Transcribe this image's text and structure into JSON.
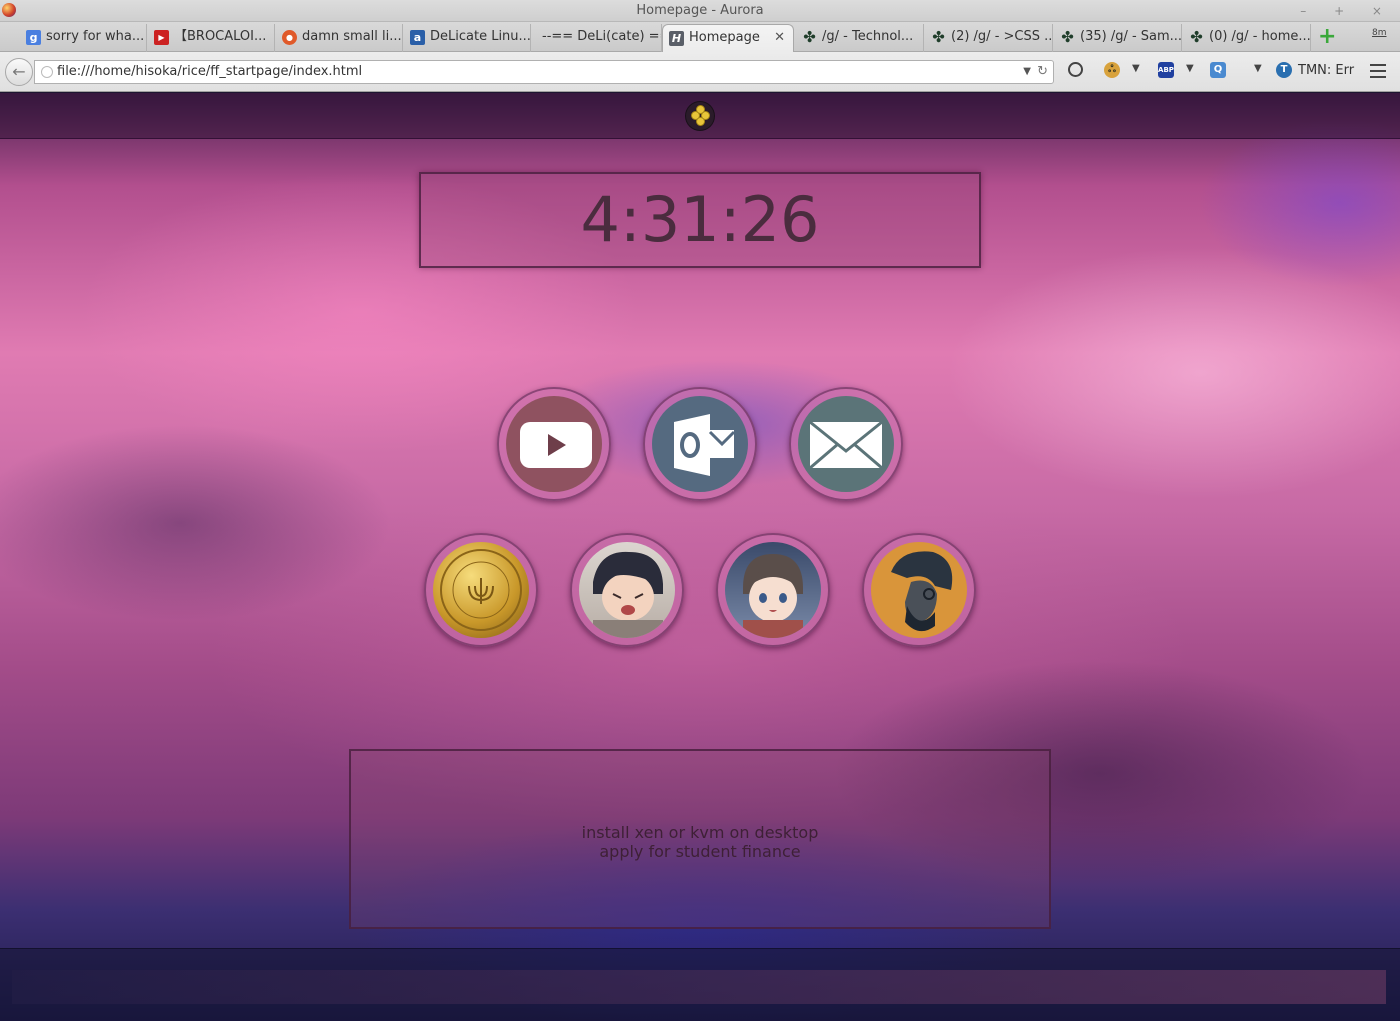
{
  "window": {
    "title": "Homepage - Aurora",
    "controls": "– + ×"
  },
  "tabs": [
    {
      "label": "sorry for wha...",
      "icon": "google-icon",
      "fav": "g",
      "color": "#4a7fe0"
    },
    {
      "label": "【BROCALOI...",
      "icon": "youtube-icon",
      "fav": "▶",
      "color": "#cc2222"
    },
    {
      "label": "damn small li...",
      "icon": "duckduckgo-icon",
      "fav": "●",
      "color": "#e05a2a"
    },
    {
      "label": "DeLicate Linu...",
      "icon": "site-a-icon",
      "fav": "a",
      "color": "#2a5fa8"
    },
    {
      "label": "--== DeLi(cate) ==--",
      "icon": "blank-page-icon",
      "fav": "",
      "color": "transparent"
    },
    {
      "label": "Homepage",
      "icon": "h-page-icon",
      "fav": "H",
      "color": "#5a5f68",
      "close": "✕"
    },
    {
      "label": "/g/ - Technol...",
      "icon": "4chan-clover-icon",
      "fav": "✤",
      "color": "transparent"
    },
    {
      "label": "(2) /g/ - >CSS ...",
      "icon": "4chan-clover-icon",
      "fav": "✤",
      "color": "transparent"
    },
    {
      "label": "(35) /g/ - Sam...",
      "icon": "4chan-clover-icon",
      "fav": "✤",
      "color": "transparent"
    },
    {
      "label": "(0) /g/ - home...",
      "icon": "4chan-clover-icon",
      "fav": "✤",
      "color": "transparent"
    }
  ],
  "new_tab": "+",
  "tab_count": "8m",
  "nav": {
    "url": "file:///home/hisoka/rice/ff_startpage/index.html",
    "tmn_label": "TMN: Err",
    "toolbar_icons": [
      "palette-icon",
      "greasemonkey-icon",
      "adblock-icon",
      "quickjava-icon",
      "trackmenot-icon"
    ]
  },
  "page": {
    "clock": "4:31:26",
    "links_row1": [
      "youtube-icon",
      "outlook-icon",
      "mail-icon"
    ],
    "links_row2": [
      "coin-avatar",
      "crying-anime-avatar",
      "anime-boy-avatar",
      "bearded-man-avatar"
    ],
    "notes": [
      "install xen or kvm on desktop",
      "apply for student finance"
    ]
  }
}
